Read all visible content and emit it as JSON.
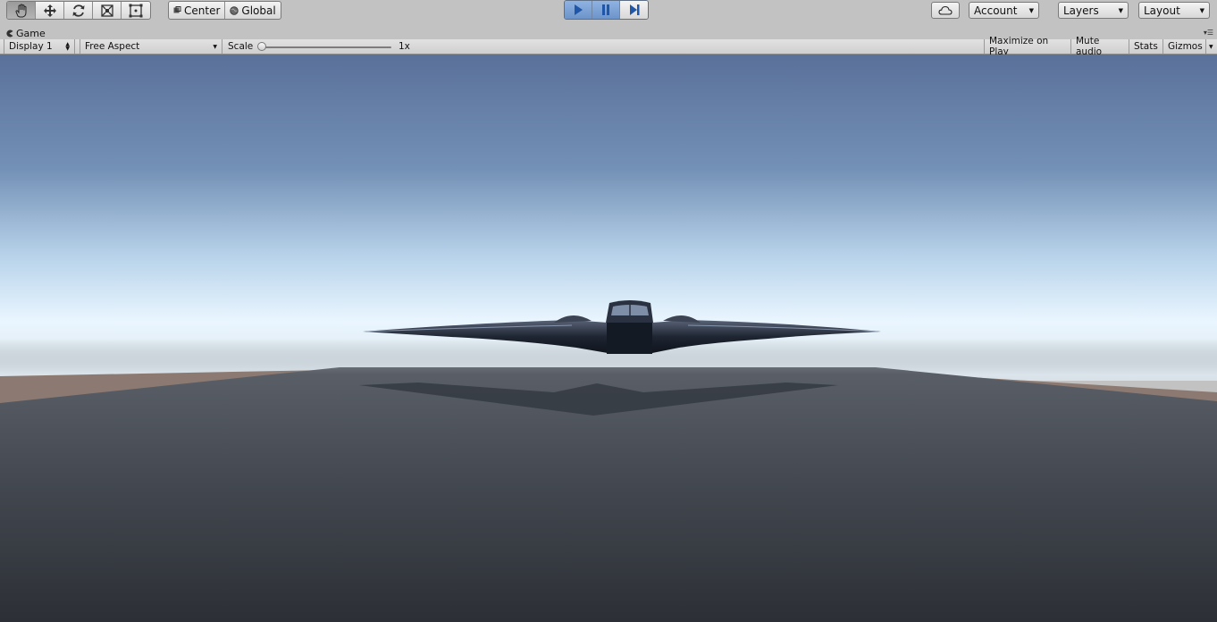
{
  "toolbar": {
    "tools": [
      {
        "name": "hand",
        "icon": "hand-icon"
      },
      {
        "name": "move",
        "icon": "move-icon"
      },
      {
        "name": "rotate",
        "icon": "rotate-icon"
      },
      {
        "name": "scale",
        "icon": "scale-icon"
      },
      {
        "name": "rect",
        "icon": "rect-transform-icon"
      }
    ],
    "pivot_label": "Center",
    "space_label": "Global",
    "account_label": "Account",
    "layers_label": "Layers",
    "layout_label": "Layout"
  },
  "game_tab": {
    "title": "Game"
  },
  "game_toolbar": {
    "display": "Display 1",
    "aspect": "Free Aspect",
    "scale_label": "Scale",
    "scale_value": "1x",
    "maximize": "Maximize on Play",
    "mute": "Mute audio",
    "stats": "Stats",
    "gizmos": "Gizmos"
  },
  "colors": {
    "play_active": "#7aa0d4",
    "toolbar_bg": "#c2c2c2",
    "sky_top": "#5a739c",
    "sky_horizon": "#e9f6ff",
    "ground": "#3a3f47"
  }
}
